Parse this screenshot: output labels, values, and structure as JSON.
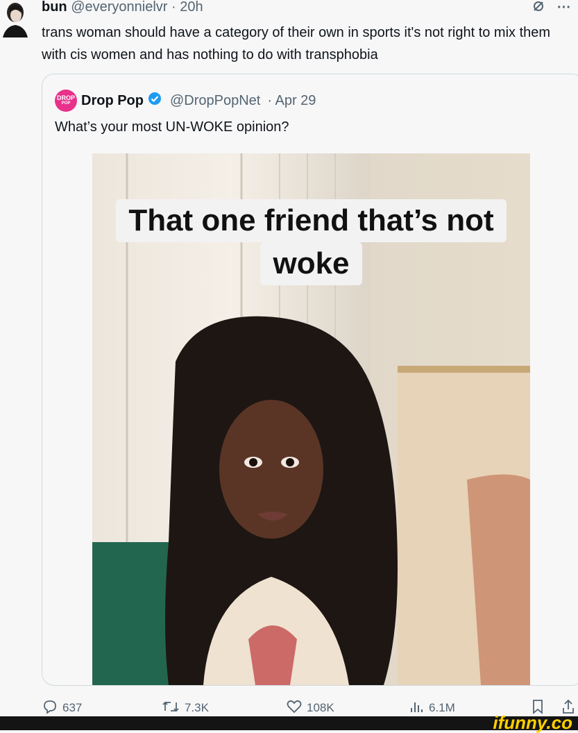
{
  "tweet": {
    "author_name": "bun",
    "author_handle": "@everyonnielvr",
    "time": "· 20h",
    "text": "trans woman should have a category of their own in sports it's not right to mix them with cis women and has nothing to do with transphobia",
    "more_label": "···"
  },
  "quote": {
    "avatar_top": "DROP",
    "avatar_bottom": "POP",
    "author_name": "Drop Pop",
    "author_handle": "@DropPopNet",
    "date": "· Apr 29",
    "text": "What’s your most UN-WOKE opinion?",
    "media": {
      "caption_line1": "That one friend that’s not",
      "caption_line2": "woke"
    }
  },
  "actions": {
    "replies": "637",
    "reposts": "7.3K",
    "likes": "108K",
    "views": "6.1M"
  },
  "watermark": "ifunny.co",
  "colors": {
    "verified": "#1d9bf0",
    "drop_pop_brand": "#e8318a",
    "secondary_text": "#536471",
    "watermark": "#ffcf00"
  }
}
